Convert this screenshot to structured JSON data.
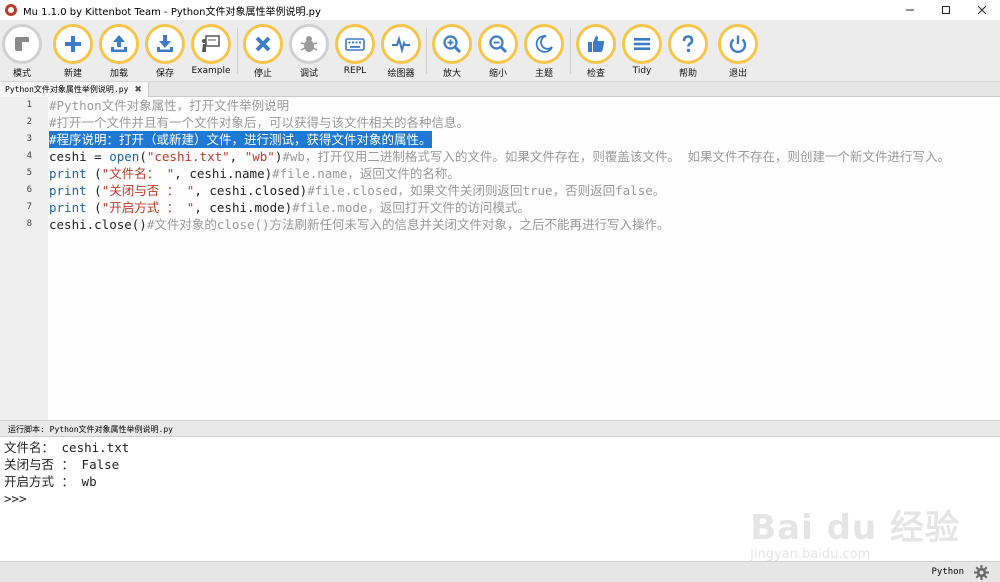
{
  "window": {
    "title": "Mu 1.1.0 by Kittenbot Team - Python文件对象属性举例说明.py",
    "controls": [
      "minimize",
      "maximize",
      "close"
    ]
  },
  "toolbar": {
    "buttons": [
      {
        "id": "mode",
        "label": "模式",
        "icon": "mode-icon"
      },
      {
        "id": "new",
        "label": "新建",
        "icon": "plus-icon"
      },
      {
        "id": "load",
        "label": "加载",
        "icon": "upload-icon"
      },
      {
        "id": "save",
        "label": "保存",
        "icon": "download-icon"
      },
      {
        "id": "example",
        "label": "Example",
        "icon": "presentation-icon"
      },
      {
        "id": "stop",
        "label": "停止",
        "icon": "close-icon"
      },
      {
        "id": "debug",
        "label": "调试",
        "icon": "bug-icon"
      },
      {
        "id": "repl",
        "label": "REPL",
        "icon": "keyboard-icon"
      },
      {
        "id": "plotter",
        "label": "绘图器",
        "icon": "pulse-icon"
      },
      {
        "id": "zoom_in",
        "label": "放大",
        "icon": "zoom-in-icon"
      },
      {
        "id": "zoom_out",
        "label": "缩小",
        "icon": "zoom-out-icon"
      },
      {
        "id": "theme",
        "label": "主题",
        "icon": "moon-icon"
      },
      {
        "id": "check",
        "label": "检查",
        "icon": "thumbs-up-icon"
      },
      {
        "id": "tidy",
        "label": "Tidy",
        "icon": "lines-icon"
      },
      {
        "id": "help",
        "label": "帮助",
        "icon": "question-icon"
      },
      {
        "id": "quit",
        "label": "退出",
        "icon": "power-icon"
      }
    ]
  },
  "tabs": [
    {
      "label": "Python文件对象属性举例说明.py",
      "active": true
    }
  ],
  "editor": {
    "line_numbers": [
      "1",
      "2",
      "3",
      "4",
      "5",
      "6",
      "7",
      "8"
    ],
    "lines": [
      {
        "parts": [
          {
            "t": "c",
            "s": "#Python文件对象属性，打开文件举例说明"
          }
        ]
      },
      {
        "parts": [
          {
            "t": "c",
            "s": "#打开一个文件并且有一个文件对象后，可以获得与该文件相关的各种信息。"
          }
        ]
      },
      {
        "selected": true,
        "parts": [
          {
            "t": "c",
            "s": "#程序说明：打开（或新建）文件，进行测试，获得文件对象的属性。"
          }
        ]
      },
      {
        "parts": [
          {
            "t": "p",
            "s": "ceshi = "
          },
          {
            "t": "k",
            "s": "open"
          },
          {
            "t": "p",
            "s": "("
          },
          {
            "t": "s",
            "s": "\"ceshi.txt\""
          },
          {
            "t": "p",
            "s": ", "
          },
          {
            "t": "s",
            "s": "\"wb\""
          },
          {
            "t": "p",
            "s": ")"
          },
          {
            "t": "c",
            "s": "#wb，打开仅用二进制格式写入的文件。如果文件存在，则覆盖该文件。 如果文件不存在，则创建一个新文件进行写入。"
          }
        ]
      },
      {
        "parts": [
          {
            "t": "k",
            "s": "print"
          },
          {
            "t": "p",
            "s": " ("
          },
          {
            "t": "s",
            "s": "\"文件名： \""
          },
          {
            "t": "p",
            "s": ", ceshi.name)"
          },
          {
            "t": "c",
            "s": "#file.name，返回文件的名称。"
          }
        ]
      },
      {
        "parts": [
          {
            "t": "k",
            "s": "print"
          },
          {
            "t": "p",
            "s": " ("
          },
          {
            "t": "s",
            "s": "\"关闭与否 ： \""
          },
          {
            "t": "p",
            "s": ", ceshi.closed)"
          },
          {
            "t": "c",
            "s": "#file.closed，如果文件关闭则返回true，否则返回false。"
          }
        ]
      },
      {
        "parts": [
          {
            "t": "k",
            "s": "print"
          },
          {
            "t": "p",
            "s": " ("
          },
          {
            "t": "s",
            "s": "\"开启方式 ： \""
          },
          {
            "t": "p",
            "s": ", ceshi.mode)"
          },
          {
            "t": "c",
            "s": "#file.mode，返回打开文件的访问模式。"
          }
        ]
      },
      {
        "parts": [
          {
            "t": "p",
            "s": "ceshi.close()"
          },
          {
            "t": "c",
            "s": "#文件对象的close()方法刷新任何未写入的信息并关闭文件对象，之后不能再进行写入操作。"
          }
        ]
      }
    ]
  },
  "repl": {
    "title": "运行脚本: Python文件对象属性举例说明.py",
    "output_lines": [
      "文件名：  ceshi.txt",
      "关闭与否 ：  False",
      "开启方式 ：  wb",
      ">>> "
    ]
  },
  "watermark": {
    "logo": "Bai du 经验",
    "url": "jingyan.baidu.com"
  },
  "status": {
    "mode": "Python",
    "settings_icon": "gear-icon"
  },
  "colors": {
    "accent_ring": "#f5c64b",
    "selection": "#1f78d4",
    "keyword": "#1d64b8",
    "string": "#c0392b",
    "comment": "#9a9a9a"
  }
}
